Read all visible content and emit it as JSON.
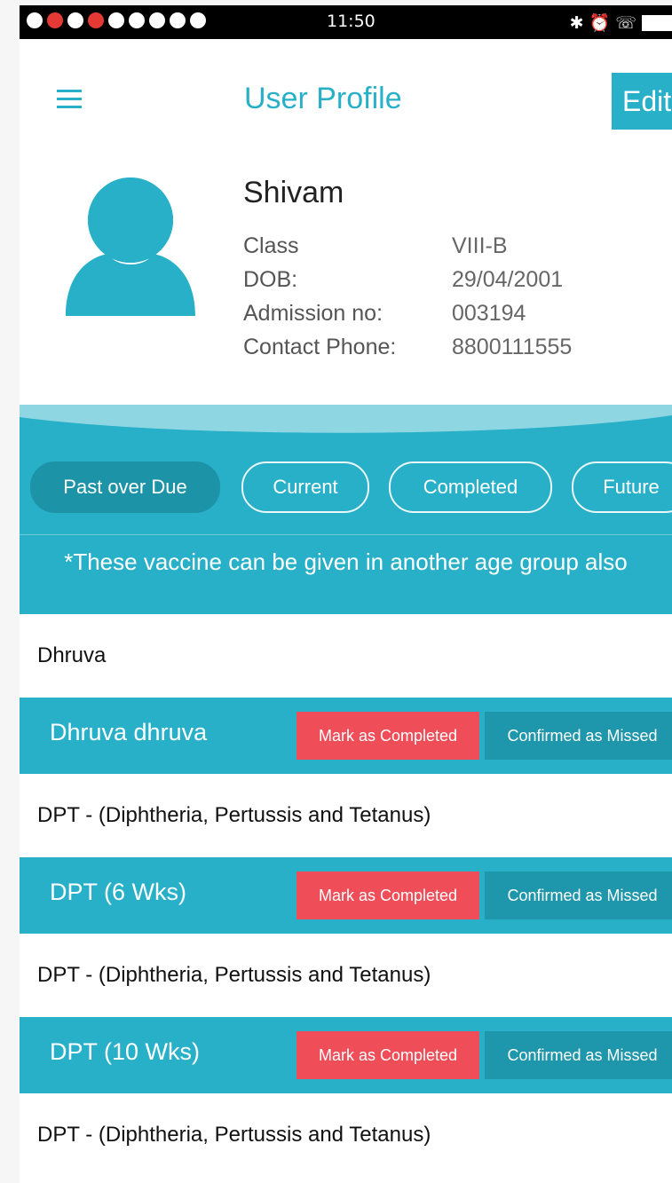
{
  "status_bar": {
    "time": "11:50"
  },
  "header": {
    "title": "User Profile",
    "edit_label": "Edit"
  },
  "profile": {
    "name": "Shivam",
    "fields": [
      {
        "label": "Class",
        "value": "VIII-B"
      },
      {
        "label": "DOB:",
        "value": "29/04/2001"
      },
      {
        "label": "Admission no:",
        "value": "003194"
      },
      {
        "label": "Contact Phone:",
        "value": "8800111555"
      }
    ]
  },
  "tabs": [
    {
      "label": "Past over Due",
      "active": true
    },
    {
      "label": "Current",
      "active": false
    },
    {
      "label": "Completed",
      "active": false
    },
    {
      "label": "Future",
      "active": false
    }
  ],
  "note": "*These vaccine can be given in another age group also",
  "list": {
    "groups": [
      {
        "label": "Dhruva",
        "vaccine": "Dhruva dhruva"
      },
      {
        "label": "DPT - (Diphtheria, Pertussis and Tetanus)",
        "vaccine": "DPT (6 Wks)"
      },
      {
        "label": "DPT - (Diphtheria, Pertussis and Tetanus)",
        "vaccine": "DPT (10 Wks)"
      },
      {
        "label": "DPT - (Diphtheria, Pertussis and Tetanus)"
      }
    ],
    "mark_completed_label": "Mark as Completed",
    "confirmed_missed_label": "Confirmed as Missed"
  },
  "colors": {
    "accent": "#27b0c8",
    "danger": "#ef4e58",
    "dark_accent": "#1e96ab"
  }
}
